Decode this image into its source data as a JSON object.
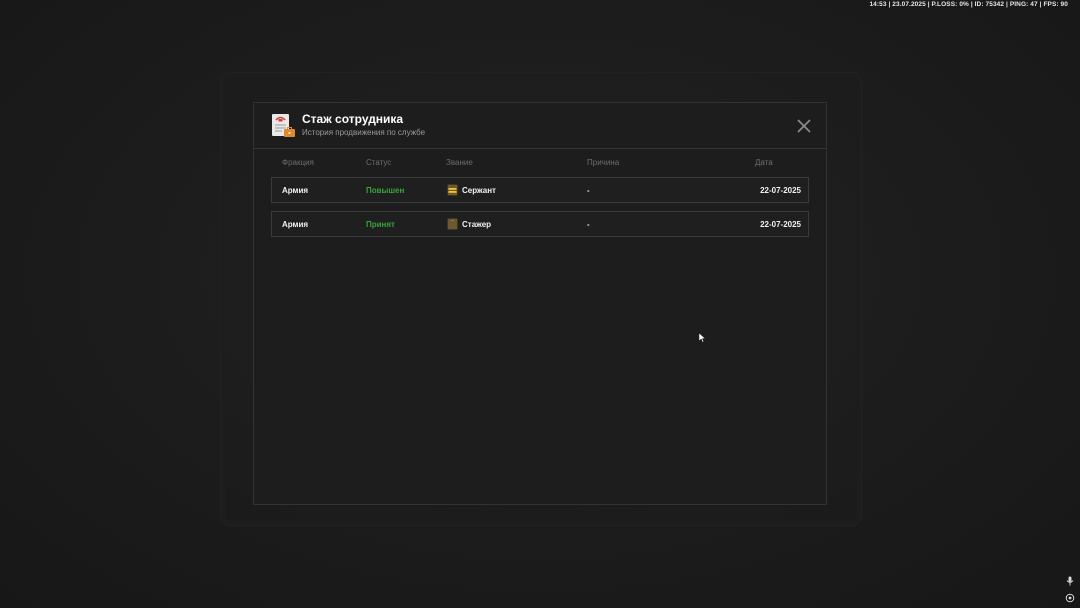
{
  "hud": {
    "text": "14:53 | 23.07.2025 | P.LOSS: 0% | ID: 75342 | PING: 47 | FPS: 90"
  },
  "modal": {
    "title": "Стаж сотрудника",
    "subtitle": "История продвижения по службе",
    "icon": "document-certificate-icon",
    "close_icon": "close-icon"
  },
  "table": {
    "columns": [
      "Фракция",
      "Статус",
      "Звание",
      "Причина",
      "Дата"
    ],
    "rows": [
      {
        "faction": "Армия",
        "status": "Повышен",
        "rank_icon": "sergeant-badge-icon",
        "rank": "Сержант",
        "reason": "-",
        "date": "22-07-2025"
      },
      {
        "faction": "Армия",
        "status": "Принят",
        "rank_icon": "trainee-badge-icon",
        "rank": "Стажер",
        "reason": "-",
        "date": "22-07-2025"
      }
    ]
  },
  "colors": {
    "status_green": "#3aa33a",
    "modal_bg": "#1d1d1d",
    "border": "#3a3a3a"
  }
}
